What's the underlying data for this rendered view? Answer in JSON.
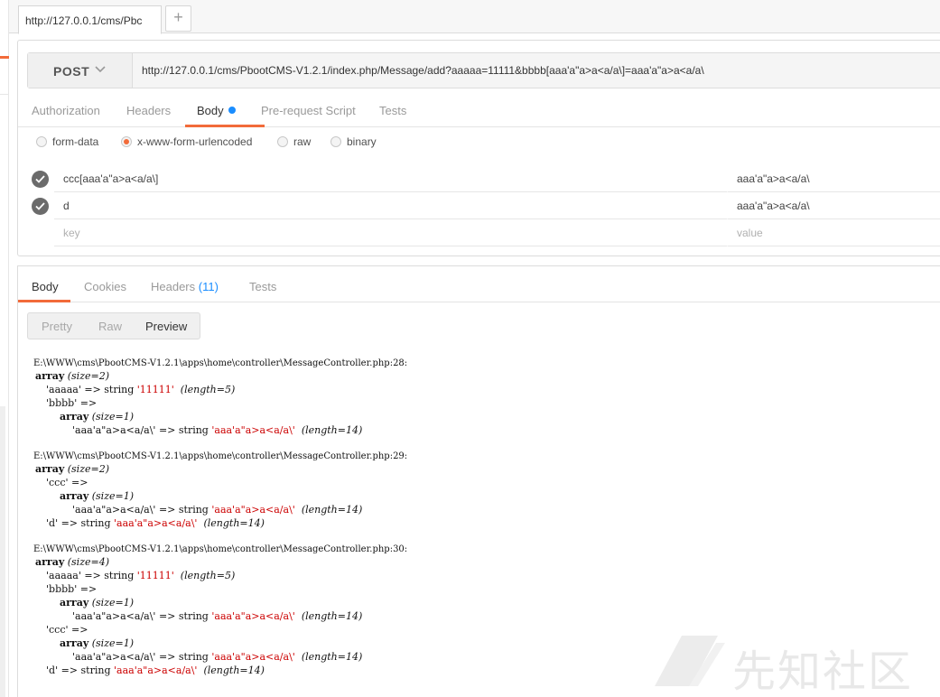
{
  "tab": {
    "title": "http://127.0.0.1/cms/Pbc",
    "add": "+"
  },
  "request": {
    "method": "POST",
    "url": "http://127.0.0.1/cms/PbootCMS-V1.2.1/index.php/Message/add?aaaaa=11111&bbbb[aaa'a\"a>a<a/a\\]=aaa'a\"a>a<a/a\\",
    "tabs": [
      "Authorization",
      "Headers",
      "Body",
      "Pre-request Script",
      "Tests"
    ],
    "active_tab": "Body",
    "body_types": [
      "form-data",
      "x-www-form-urlencoded",
      "raw",
      "binary"
    ],
    "selected_body_type": "x-www-form-urlencoded",
    "params": [
      {
        "key": "ccc[aaa'a\"a>a<a/a\\]",
        "value": "aaa'a\"a>a<a/a\\"
      },
      {
        "key": "d",
        "value": "aaa'a\"a>a<a/a\\"
      }
    ],
    "key_placeholder": "key",
    "value_placeholder": "value"
  },
  "response": {
    "tabs": [
      "Body",
      "Cookies",
      "Headers",
      "Tests"
    ],
    "headers_count": "(11)",
    "view_modes": [
      "Pretty",
      "Raw",
      "Preview"
    ],
    "active_view": "Preview",
    "dumps": [
      {
        "path": "E:\\WWW\\cms\\PbootCMS-V1.2.1\\apps\\home\\controller\\MessageController.php:28:",
        "size": "(size=2)",
        "lines": [
          {
            "key": "'aaaaa'",
            "str": "'11111'",
            "len": "(length=5)"
          },
          {
            "key": "'bbbb'",
            "nested_size": "(size=1)",
            "inner_key": "'aaa'a\"a>a<a/a\\'",
            "str": "'aaa'a\"a>a<a/a\\'",
            "len": "(length=14)"
          }
        ]
      },
      {
        "path": "E:\\WWW\\cms\\PbootCMS-V1.2.1\\apps\\home\\controller\\MessageController.php:29:",
        "size": "(size=2)",
        "lines": [
          {
            "key": "'ccc'",
            "nested_size": "(size=1)",
            "inner_key": "'aaa'a\"a>a<a/a\\'",
            "str": "'aaa'a\"a>a<a/a\\'",
            "len": "(length=14)"
          },
          {
            "key": "'d'",
            "str": "'aaa'a\"a>a<a/a\\'",
            "len": "(length=14)"
          }
        ]
      },
      {
        "path": "E:\\WWW\\cms\\PbootCMS-V1.2.1\\apps\\home\\controller\\MessageController.php:30:",
        "size": "(size=4)",
        "lines": [
          {
            "key": "'aaaaa'",
            "str": "'11111'",
            "len": "(length=5)"
          },
          {
            "key": "'bbbb'",
            "nested_size": "(size=1)",
            "inner_key": "'aaa'a\"a>a<a/a\\'",
            "str": "'aaa'a\"a>a<a/a\\'",
            "len": "(length=14)"
          },
          {
            "key": "'ccc'",
            "nested_size": "(size=1)",
            "inner_key": "'aaa'a\"a>a<a/a\\'",
            "str": "'aaa'a\"a>a<a/a\\'",
            "len": "(length=14)"
          },
          {
            "key": "'d'",
            "str": "'aaa'a\"a>a<a/a\\'",
            "len": "(length=14)"
          }
        ]
      }
    ],
    "labels": {
      "array": "array",
      "arrow": "=>",
      "string": "string"
    }
  },
  "watermark": {
    "text": "先知社区"
  },
  "colors": {
    "accent": "#f26b3a",
    "active_dot": "#1a8dff",
    "dump_string": "#cc0000"
  }
}
